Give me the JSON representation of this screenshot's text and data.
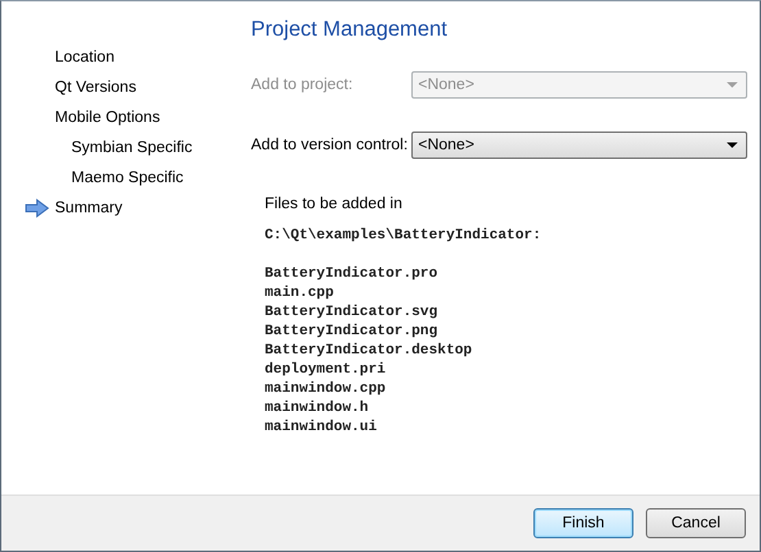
{
  "sidebar": {
    "items": [
      {
        "label": "Location",
        "selected": false
      },
      {
        "label": "Qt Versions",
        "selected": false
      },
      {
        "label": "Mobile Options",
        "selected": false,
        "children": [
          {
            "label": "Symbian Specific",
            "selected": false
          },
          {
            "label": "Maemo Specific",
            "selected": false
          }
        ]
      },
      {
        "label": "Summary",
        "selected": true
      }
    ]
  },
  "page": {
    "title": "Project Management",
    "fields": [
      {
        "label": "Add to project:",
        "value": "<None>",
        "disabled": true
      },
      {
        "label": "Add to version control:",
        "value": "<None>",
        "disabled": false
      }
    ],
    "files_heading": "Files to be added in",
    "directory": "C:\\Qt\\examples\\BatteryIndicator:",
    "files": [
      "BatteryIndicator.pro",
      "main.cpp",
      "BatteryIndicator.svg",
      "BatteryIndicator.png",
      "BatteryIndicator.desktop",
      "deployment.pri",
      "mainwindow.cpp",
      "mainwindow.h",
      "mainwindow.ui"
    ]
  },
  "buttons": [
    {
      "label": "Finish",
      "default": true
    },
    {
      "label": "Cancel",
      "default": false
    }
  ]
}
